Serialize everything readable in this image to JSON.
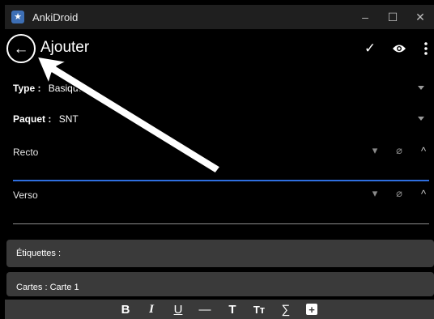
{
  "window": {
    "title": "AnkiDroid",
    "controls": [
      "–",
      "☐",
      "✕"
    ]
  },
  "toolbar": {
    "title": "Ajouter",
    "back_icon": "arrow-left-icon",
    "actions": [
      "check-icon",
      "eye-icon",
      "more-vert-icon"
    ]
  },
  "form": {
    "type": {
      "label": "Type :",
      "value": "Basique"
    },
    "deck": {
      "label": "Paquet :",
      "value": "SNT"
    },
    "fields": [
      {
        "label": "Recto",
        "value": ""
      },
      {
        "label": "Verso",
        "value": ""
      }
    ],
    "tags_label": "Étiquettes :",
    "cards_label": "Cartes : Carte 1"
  },
  "format_bar": {
    "bold": "B",
    "italic": "I",
    "underline": "U",
    "hr": "—",
    "font_size": "T",
    "title_case": "Tт",
    "math": "∑",
    "insert": "+"
  },
  "colors": {
    "accent_line": "#2f6fe0",
    "background": "#000000",
    "section": "#3a3a3a"
  }
}
